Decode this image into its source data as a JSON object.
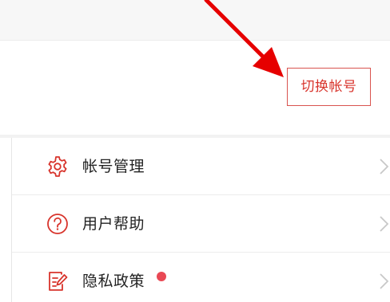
{
  "account": {
    "switch_label": "切换帐号"
  },
  "menu": {
    "items": [
      {
        "label": "帐号管理",
        "icon": "gear-icon",
        "badge": false
      },
      {
        "label": "用户帮助",
        "icon": "question-circle-icon",
        "badge": false
      },
      {
        "label": "隐私政策",
        "icon": "edit-document-icon",
        "badge": true
      }
    ]
  },
  "colors": {
    "accent": "#d8342c",
    "annotation_arrow": "#e60000",
    "badge": "#e94854",
    "text": "#222222",
    "divider": "#ececec"
  }
}
